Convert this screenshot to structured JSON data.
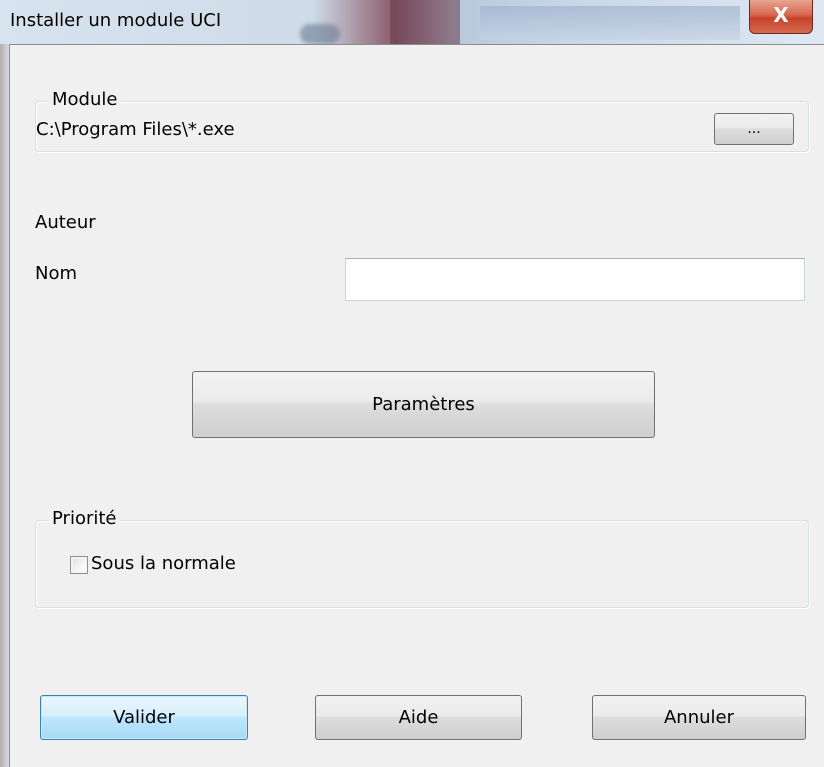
{
  "window": {
    "title": "Installer un module UCI",
    "close_label": "X"
  },
  "module_group": {
    "legend": "Module",
    "path": "C:\\Program Files\\*.exe",
    "browse_label": "..."
  },
  "author": {
    "label": "Auteur"
  },
  "name": {
    "label": "Nom",
    "value": ""
  },
  "parameters_button": {
    "label": "Paramètres"
  },
  "priority_group": {
    "legend": "Priorité",
    "checkbox_label": "Sous la normale",
    "checked": false
  },
  "footer": {
    "ok_label": "Valider",
    "help_label": "Aide",
    "cancel_label": "Annuler"
  }
}
